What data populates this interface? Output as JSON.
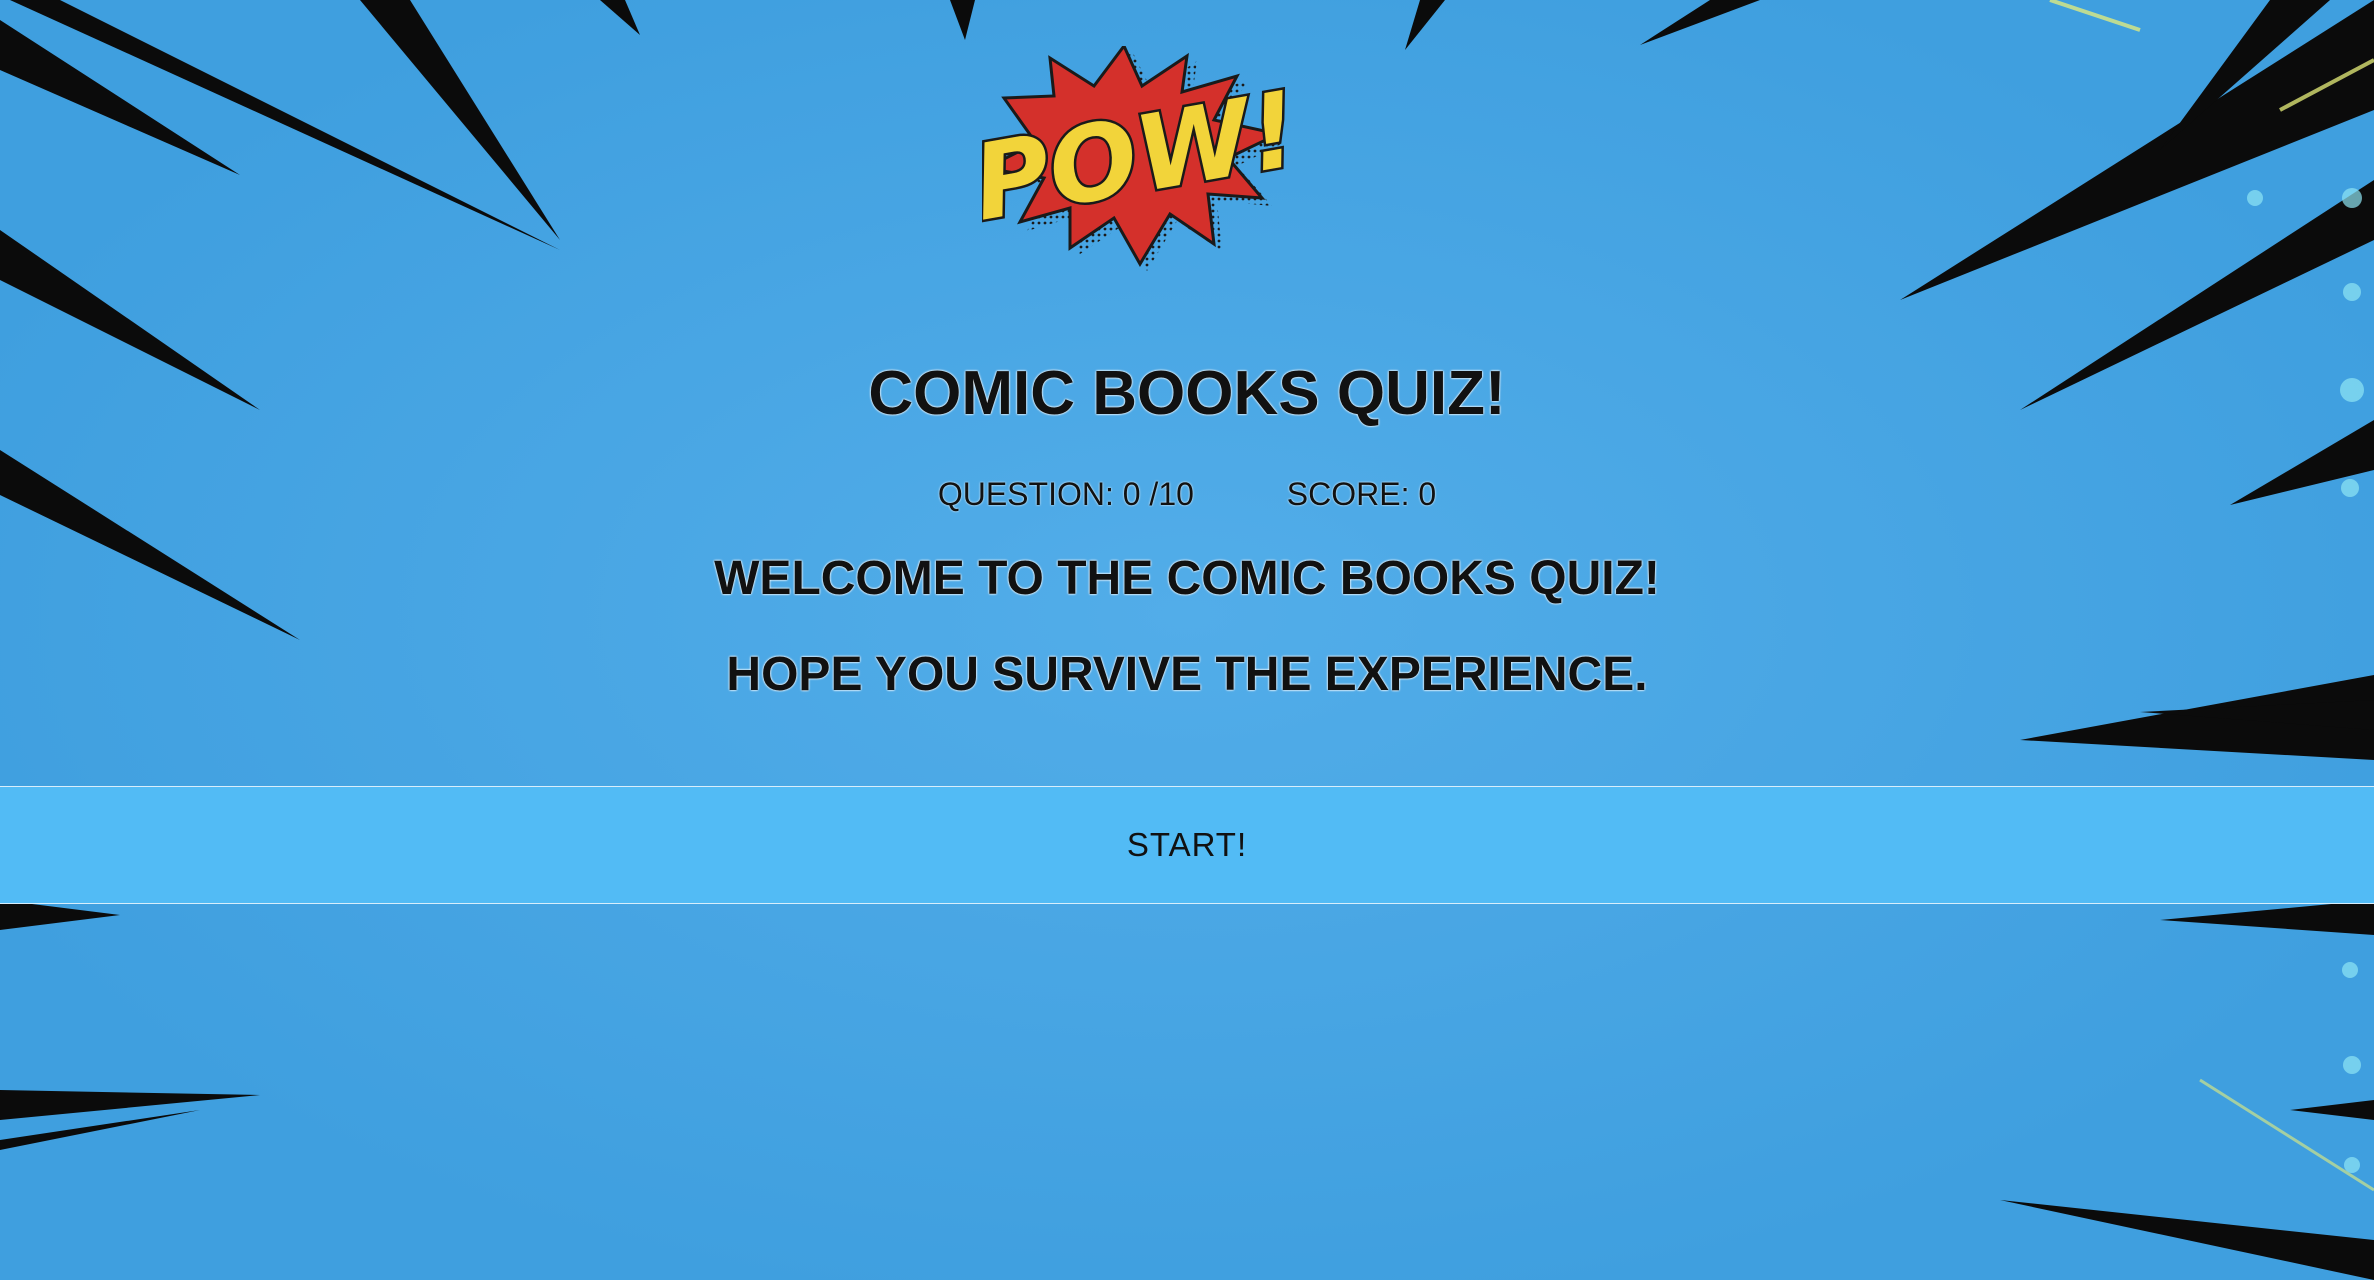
{
  "logo": {
    "text": "POW!",
    "icon": "pow-burst-icon"
  },
  "quiz": {
    "title": "COMIC BOOKS QUIZ!",
    "question_label": "QUESTION: 0 /10",
    "score_label": "SCORE: 0",
    "welcome_line_1": "WELCOME TO THE COMIC BOOKS QUIZ!",
    "welcome_line_2": "HOPE YOU SURVIVE THE EXPERIENCE.",
    "start_label": "START!"
  },
  "colors": {
    "background": "#4aa8e6",
    "start_bar": "#52bbf5",
    "burst_red": "#d4302b",
    "burst_yellow": "#f2d43a"
  }
}
